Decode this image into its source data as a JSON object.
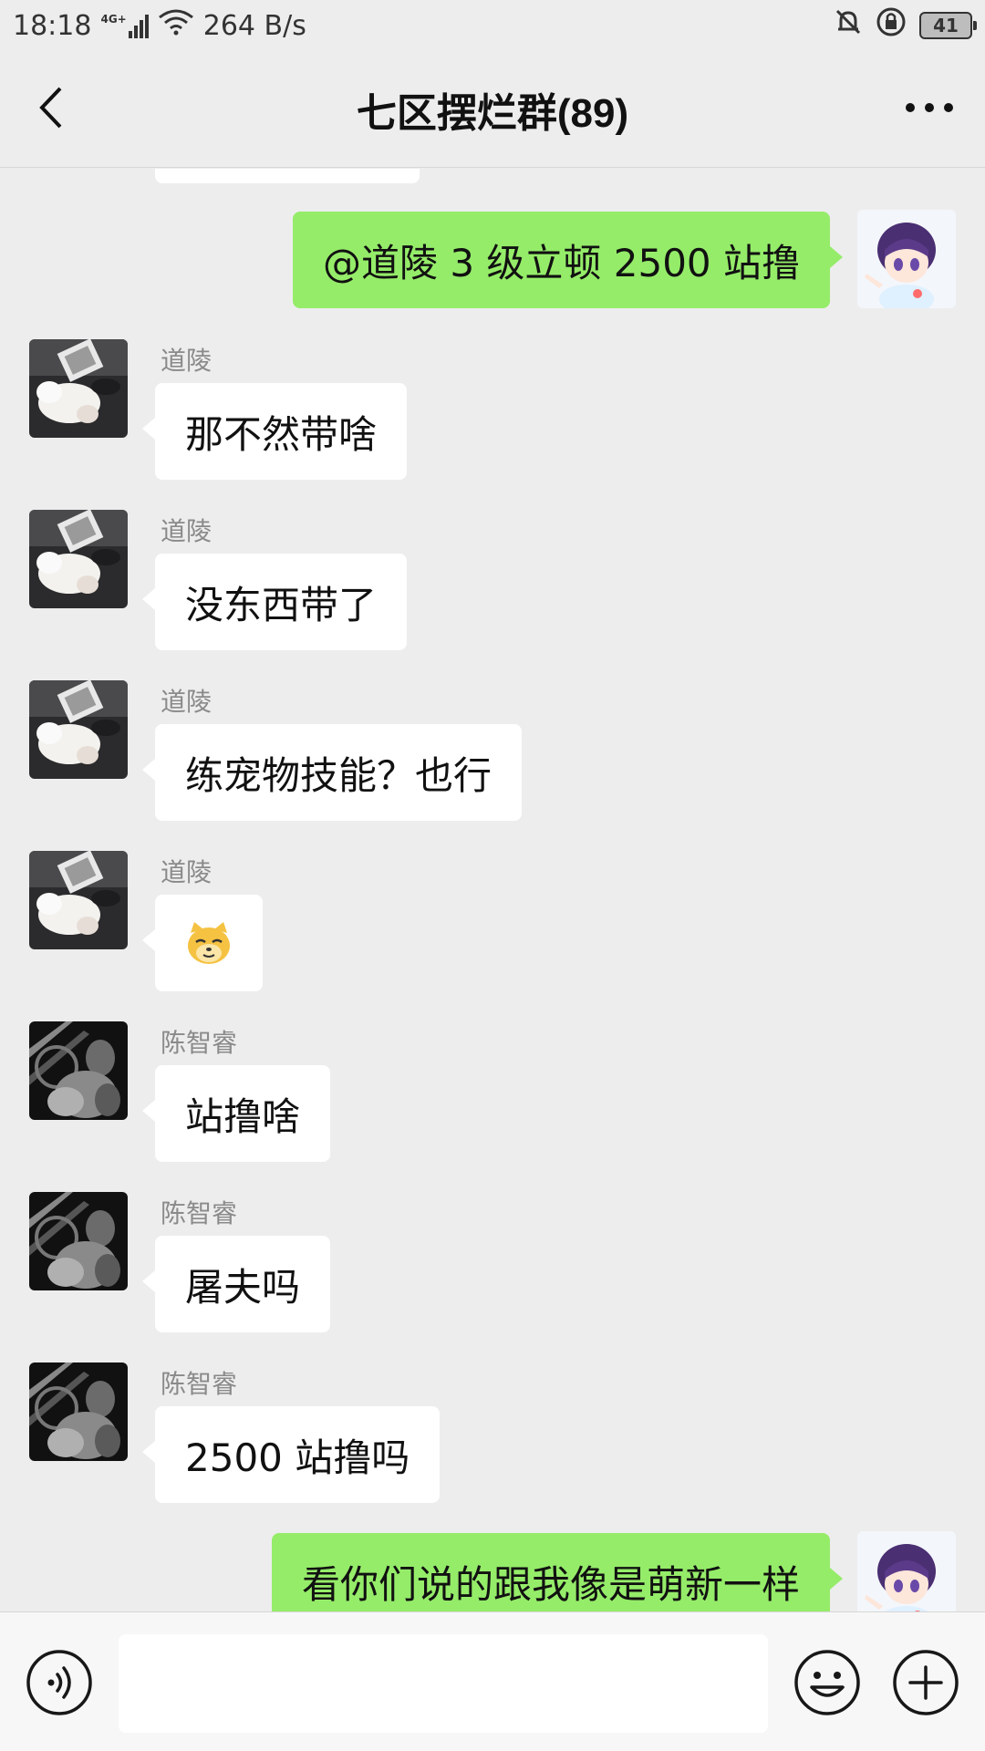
{
  "status": {
    "time": "18:18",
    "network": "4G+",
    "speed": "264 B/s",
    "battery": "41"
  },
  "header": {
    "title": "七区摆烂群(89)"
  },
  "messages": [
    {
      "direction": "out",
      "text": "@道陵  3 级立顿 2500 站撸"
    },
    {
      "direction": "in",
      "sender": "道陵",
      "text": "那不然带啥"
    },
    {
      "direction": "in",
      "sender": "道陵",
      "text": "没东西带了"
    },
    {
      "direction": "in",
      "sender": "道陵",
      "text": "练宠物技能？也行"
    },
    {
      "direction": "in",
      "sender": "道陵",
      "sticker": "doge-emoji"
    },
    {
      "direction": "in",
      "sender": "陈智睿",
      "text": "站撸啥"
    },
    {
      "direction": "in",
      "sender": "陈智睿",
      "text": "屠夫吗"
    },
    {
      "direction": "in",
      "sender": "陈智睿",
      "text": "2500 站撸吗"
    },
    {
      "direction": "out",
      "text": "看你们说的跟我像是萌新一样"
    }
  ],
  "input": {
    "value": ""
  },
  "icons": {
    "back": "chevron-left-icon",
    "more": "more-dots-icon",
    "voice": "voice-icon",
    "emoji": "emoji-icon",
    "plus": "plus-icon"
  },
  "colors": {
    "background": "#ededed",
    "outgoing_bubble": "#95ec69",
    "incoming_bubble": "#ffffff"
  }
}
